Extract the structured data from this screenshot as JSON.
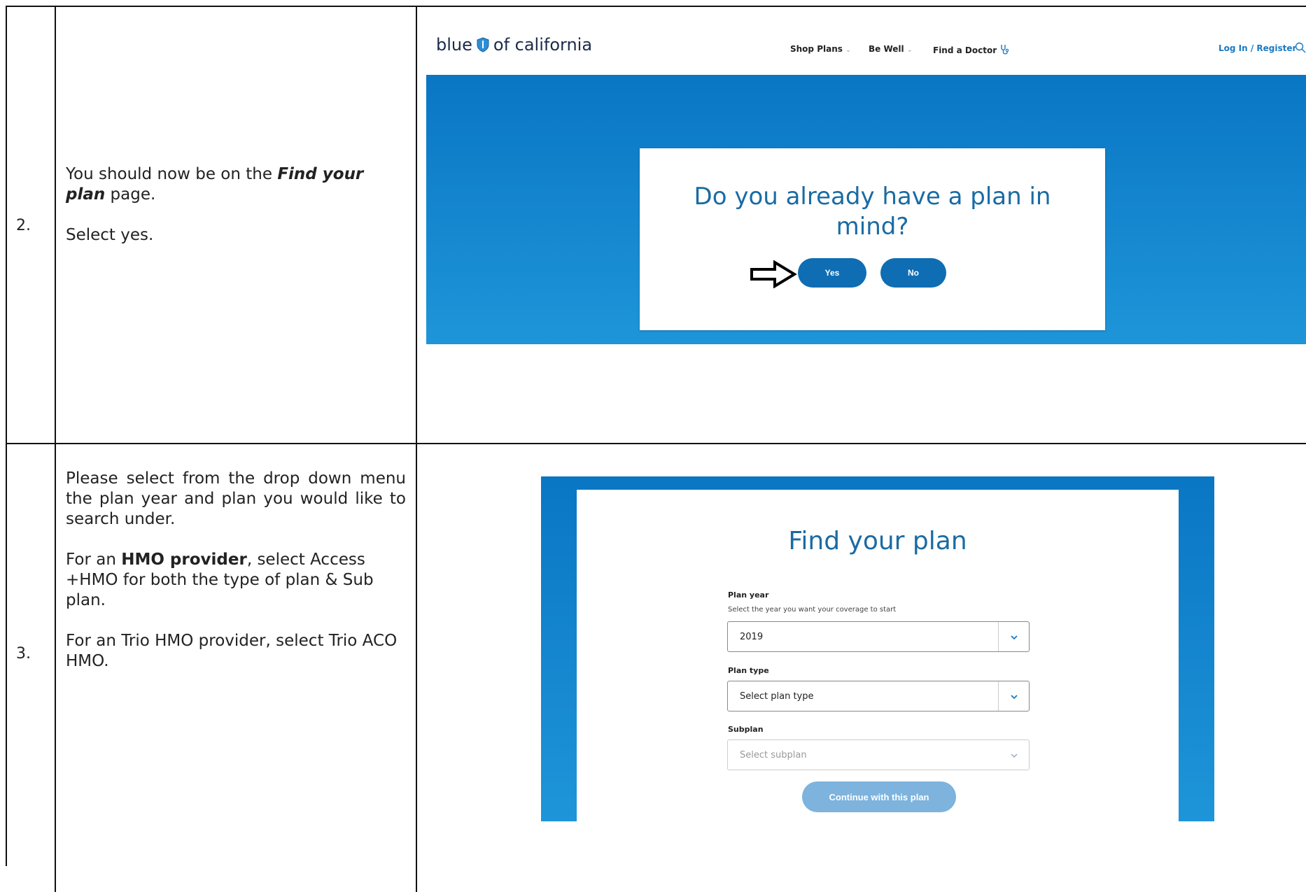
{
  "rows": [
    {
      "number": "2.",
      "instructions": {
        "line1_pre": "You should now be on the ",
        "line1_emph": "Find your plan",
        "line1_post": " page.",
        "line2": "Select yes."
      }
    },
    {
      "number": "3.",
      "instructions": {
        "p1": "Please select from the drop down menu the plan year and plan you would like to search under.",
        "p2_pre": "For an ",
        "p2_bold": "HMO provider",
        "p2_post": ", select Access +HMO for both the type of plan & Sub plan.",
        "p3": "For an Trio HMO provider, select Trio ACO HMO."
      }
    }
  ],
  "screenshot1": {
    "logo": {
      "left": "blue",
      "right": "of california"
    },
    "nav": {
      "shop_plans": "Shop Plans",
      "be_well": "Be Well",
      "find_doctor": "Find a Doctor",
      "login": "Log In / Register"
    },
    "question": "Do you already have a plan in mind?",
    "yes_label": "Yes",
    "no_label": "No",
    "colors": {
      "brand_blue": "#0a76c4",
      "button_blue": "#0f6db3",
      "title_blue": "#1a6ba4"
    }
  },
  "screenshot2": {
    "title": "Find your plan",
    "plan_year": {
      "label": "Plan year",
      "help": "Select the year you want your coverage to start",
      "value": "2019"
    },
    "plan_type": {
      "label": "Plan type",
      "value": "Select plan type"
    },
    "subplan": {
      "label": "Subplan",
      "value": "Select subplan"
    },
    "continue_label": "Continue with this plan",
    "colors": {
      "continue_disabled": "#7db3dd"
    }
  }
}
